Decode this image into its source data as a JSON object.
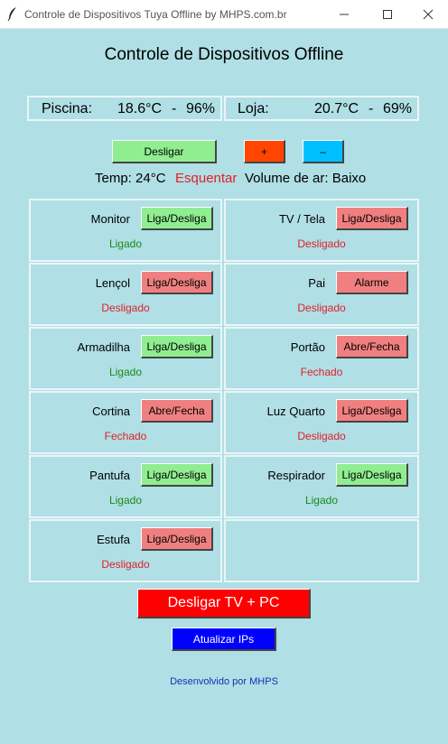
{
  "window": {
    "title": "Controle de Dispositivos Tuya Offline by MHPS.com.br",
    "minimize_label": "minimize",
    "maximize_label": "maximize",
    "close_label": "close"
  },
  "heading": "Controle de Dispositivos Offline",
  "sensors": {
    "piscina": {
      "name": "Piscina:",
      "temp": "18.6°C",
      "sep": "-",
      "humidity": "96%"
    },
    "loja": {
      "name": "Loja:",
      "temp": "20.7°C",
      "sep": "-",
      "humidity": "69%"
    }
  },
  "ac": {
    "power_label": "Desligar",
    "plus_label": "+",
    "minus_label": "–",
    "temp_text": "Temp: 24°C",
    "mode_text": "Esquentar",
    "volume_text": "Volume de ar: Baixo"
  },
  "devices": [
    {
      "name": "Monitor",
      "button": "Liga/Desliga",
      "state": "Ligado"
    },
    {
      "name": "TV / Tela",
      "button": "Liga/Desliga",
      "state": "Desligado"
    },
    {
      "name": "Lençol",
      "button": "Liga/Desliga",
      "state": "Desligado"
    },
    {
      "name": "Pai",
      "button": "Alarme",
      "state": "Desligado"
    },
    {
      "name": "Armadilha",
      "button": "Liga/Desliga",
      "state": "Ligado"
    },
    {
      "name": "Portão",
      "button": "Abre/Fecha",
      "state": "Fechado"
    },
    {
      "name": "Cortina",
      "button": "Abre/Fecha",
      "state": "Fechado"
    },
    {
      "name": "Luz Quarto",
      "button": "Liga/Desliga",
      "state": "Desligado"
    },
    {
      "name": "Pantufa",
      "button": "Liga/Desliga",
      "state": "Ligado"
    },
    {
      "name": "Respirador",
      "button": "Liga/Desliga",
      "state": "Ligado"
    },
    {
      "name": "Estufa",
      "button": "Liga/Desliga",
      "state": "Desligado"
    }
  ],
  "actions": {
    "shutdown_label": "Desligar TV + PC",
    "update_ips_label": "Atualizar IPs"
  },
  "footer": "Desenvolvido por MHPS",
  "colors": {
    "background": "#b0dfe5",
    "on_button": "#90ee90",
    "off_button": "#f08080",
    "on_text": "#1a8a1a",
    "off_text": "#e0202a",
    "plus_button": "#ff4500",
    "minus_button": "#00bfff",
    "shutdown_button": "#ff0000",
    "update_button": "#0000ff"
  }
}
